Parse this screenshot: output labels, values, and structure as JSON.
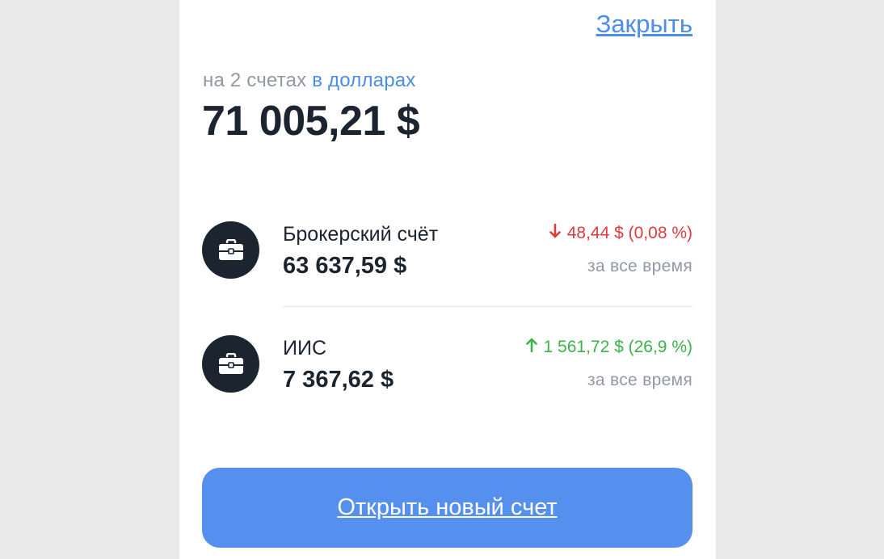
{
  "header": {
    "close_label": "Закрыть"
  },
  "summary": {
    "prefix": "на 2 счетах",
    "currency_link": "в долларах",
    "total": "71 005,21 $"
  },
  "accounts": [
    {
      "name": "Брокерский счёт",
      "amount": "63 637,59 $",
      "change": "48,44 $ (0,08 %)",
      "direction": "down",
      "period": "за все время",
      "icon": "briefcase-icon"
    },
    {
      "name": "ИИС",
      "amount": "7 367,62 $",
      "change": "1 561,72 $ (26,9 %)",
      "direction": "up",
      "period": "за все время",
      "icon": "briefcase-icon"
    }
  ],
  "footer": {
    "open_button": "Открыть новый счет"
  },
  "colors": {
    "accent": "#4a8ee8",
    "button": "#5590ee",
    "negative": "#e0393e",
    "positive": "#3bb34a",
    "text": "#1c2430",
    "muted": "#9299a3"
  }
}
